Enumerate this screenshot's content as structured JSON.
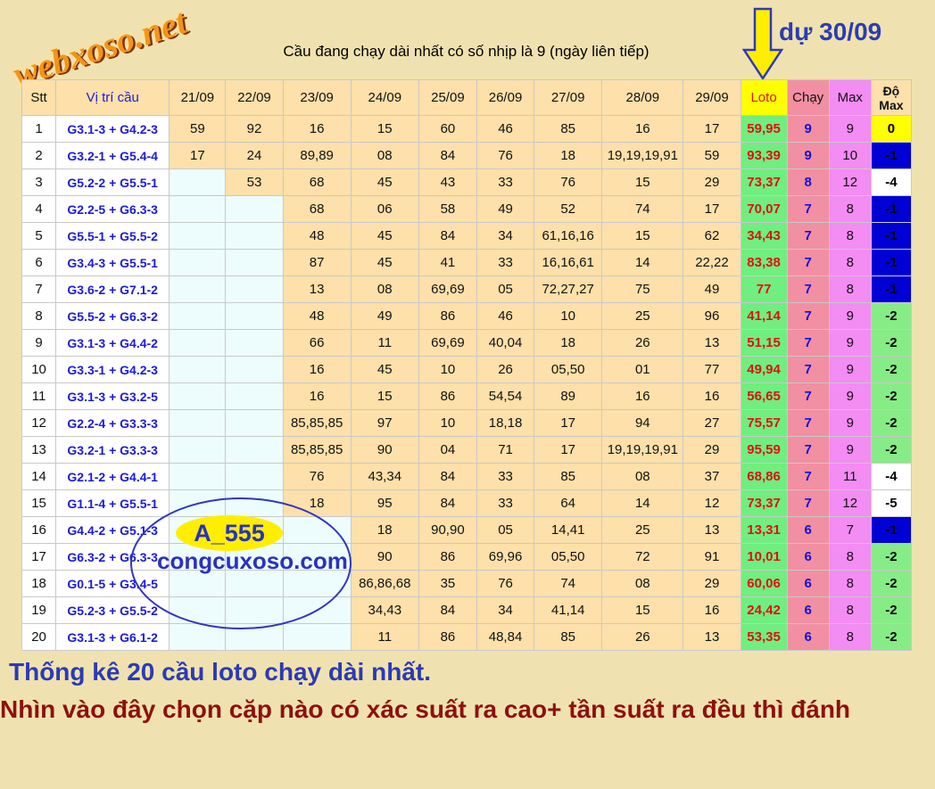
{
  "logo_text": "webxoso.net",
  "title": "Cầu đang chạy dài nhất có số nhịp là 9 (ngày liên tiếp)",
  "forecast": "dự 30/09",
  "headers": [
    "Stt",
    "Vị trí cầu",
    "21/09",
    "22/09",
    "23/09",
    "24/09",
    "25/09",
    "26/09",
    "27/09",
    "28/09",
    "29/09",
    "Loto",
    "Chạy",
    "Max",
    "Độ Max"
  ],
  "rows": [
    {
      "stt": "1",
      "pos": "G3.1-3 + G4.2-3",
      "days": [
        "59",
        "92",
        "16",
        "15",
        "60",
        "46",
        "85",
        "16",
        "17"
      ],
      "loto": "59,95",
      "chay": "9",
      "max": "9",
      "do": "0",
      "do_color": "yellow"
    },
    {
      "stt": "2",
      "pos": "G3.2-1 + G5.4-4",
      "days": [
        "17",
        "24",
        "89,89",
        "08",
        "84",
        "76",
        "18",
        "19,19,19,91",
        "59"
      ],
      "loto": "93,39",
      "chay": "9",
      "max": "10",
      "do": "-1",
      "do_color": "blue"
    },
    {
      "stt": "3",
      "pos": "G5.2-2 + G5.5-1",
      "days": [
        "",
        "53",
        "68",
        "45",
        "43",
        "33",
        "76",
        "15",
        "29"
      ],
      "loto": "73,37",
      "chay": "8",
      "max": "12",
      "do": "-4",
      "do_color": "white"
    },
    {
      "stt": "4",
      "pos": "G2.2-5 + G6.3-3",
      "days": [
        "",
        "",
        "68",
        "06",
        "58",
        "49",
        "52",
        "74",
        "17"
      ],
      "loto": "70,07",
      "chay": "7",
      "max": "8",
      "do": "-1",
      "do_color": "blue"
    },
    {
      "stt": "5",
      "pos": "G5.5-1 + G5.5-2",
      "days": [
        "",
        "",
        "48",
        "45",
        "84",
        "34",
        "61,16,16",
        "15",
        "62"
      ],
      "loto": "34,43",
      "chay": "7",
      "max": "8",
      "do": "-1",
      "do_color": "blue"
    },
    {
      "stt": "6",
      "pos": "G3.4-3 + G5.5-1",
      "days": [
        "",
        "",
        "87",
        "45",
        "41",
        "33",
        "16,16,61",
        "14",
        "22,22"
      ],
      "loto": "83,38",
      "chay": "7",
      "max": "8",
      "do": "-1",
      "do_color": "blue"
    },
    {
      "stt": "7",
      "pos": "G3.6-2 + G7.1-2",
      "days": [
        "",
        "",
        "13",
        "08",
        "69,69",
        "05",
        "72,27,27",
        "75",
        "49"
      ],
      "loto": "77",
      "chay": "7",
      "max": "8",
      "do": "-1",
      "do_color": "blue"
    },
    {
      "stt": "8",
      "pos": "G5.5-2 + G6.3-2",
      "days": [
        "",
        "",
        "48",
        "49",
        "86",
        "46",
        "10",
        "25",
        "96"
      ],
      "loto": "41,14",
      "chay": "7",
      "max": "9",
      "do": "-2",
      "do_color": "green"
    },
    {
      "stt": "9",
      "pos": "G3.1-3 + G4.4-2",
      "days": [
        "",
        "",
        "66",
        "11",
        "69,69",
        "40,04",
        "18",
        "26",
        "13"
      ],
      "loto": "51,15",
      "chay": "7",
      "max": "9",
      "do": "-2",
      "do_color": "green"
    },
    {
      "stt": "10",
      "pos": "G3.3-1 + G4.2-3",
      "days": [
        "",
        "",
        "16",
        "45",
        "10",
        "26",
        "05,50",
        "01",
        "77"
      ],
      "loto": "49,94",
      "chay": "7",
      "max": "9",
      "do": "-2",
      "do_color": "green"
    },
    {
      "stt": "11",
      "pos": "G3.1-3 + G3.2-5",
      "days": [
        "",
        "",
        "16",
        "15",
        "86",
        "54,54",
        "89",
        "16",
        "16"
      ],
      "loto": "56,65",
      "chay": "7",
      "max": "9",
      "do": "-2",
      "do_color": "green"
    },
    {
      "stt": "12",
      "pos": "G2.2-4 + G3.3-3",
      "days": [
        "",
        "",
        "85,85,85",
        "97",
        "10",
        "18,18",
        "17",
        "94",
        "27"
      ],
      "loto": "75,57",
      "chay": "7",
      "max": "9",
      "do": "-2",
      "do_color": "green"
    },
    {
      "stt": "13",
      "pos": "G3.2-1 + G3.3-3",
      "days": [
        "",
        "",
        "85,85,85",
        "90",
        "04",
        "71",
        "17",
        "19,19,19,91",
        "29"
      ],
      "loto": "95,59",
      "chay": "7",
      "max": "9",
      "do": "-2",
      "do_color": "green"
    },
    {
      "stt": "14",
      "pos": "G2.1-2 + G4.4-1",
      "days": [
        "",
        "",
        "76",
        "43,34",
        "84",
        "33",
        "85",
        "08",
        "37"
      ],
      "loto": "68,86",
      "chay": "7",
      "max": "11",
      "do": "-4",
      "do_color": "white"
    },
    {
      "stt": "15",
      "pos": "G1.1-4 + G5.5-1",
      "days": [
        "",
        "",
        "18",
        "95",
        "84",
        "33",
        "64",
        "14",
        "12"
      ],
      "loto": "73,37",
      "chay": "7",
      "max": "12",
      "do": "-5",
      "do_color": "white"
    },
    {
      "stt": "16",
      "pos": "G4.4-2 + G5.1-3",
      "days": [
        "",
        "",
        "",
        "18",
        "90,90",
        "05",
        "14,41",
        "25",
        "13"
      ],
      "loto": "13,31",
      "chay": "6",
      "max": "7",
      "do": "-1",
      "do_color": "blue"
    },
    {
      "stt": "17",
      "pos": "G6.3-2 + G6.3-3",
      "days": [
        "",
        "",
        "",
        "90",
        "86",
        "69,96",
        "05,50",
        "72",
        "91"
      ],
      "loto": "10,01",
      "chay": "6",
      "max": "8",
      "do": "-2",
      "do_color": "green"
    },
    {
      "stt": "18",
      "pos": "G0.1-5 + G3.4-5",
      "days": [
        "",
        "",
        "",
        "86,86,68",
        "35",
        "76",
        "74",
        "08",
        "29"
      ],
      "loto": "60,06",
      "chay": "6",
      "max": "8",
      "do": "-2",
      "do_color": "green"
    },
    {
      "stt": "19",
      "pos": "G5.2-3 + G5.5-2",
      "days": [
        "",
        "",
        "",
        "34,43",
        "84",
        "34",
        "41,14",
        "15",
        "16"
      ],
      "loto": "24,42",
      "chay": "6",
      "max": "8",
      "do": "-2",
      "do_color": "green"
    },
    {
      "stt": "20",
      "pos": "G3.1-3 + G6.1-2",
      "days": [
        "",
        "",
        "",
        "11",
        "86",
        "48,84",
        "85",
        "26",
        "13"
      ],
      "loto": "53,35",
      "chay": "6",
      "max": "8",
      "do": "-2",
      "do_color": "green"
    }
  ],
  "watermark_tag": "A_555",
  "watermark_site": "congcuxoso.com",
  "caption1": "Thống kê 20 cầu loto chạy dài nhất.",
  "caption2": "Nhìn vào đây chọn cặp nào có xác suất ra cao+ tần suất ra đều thì đánh"
}
